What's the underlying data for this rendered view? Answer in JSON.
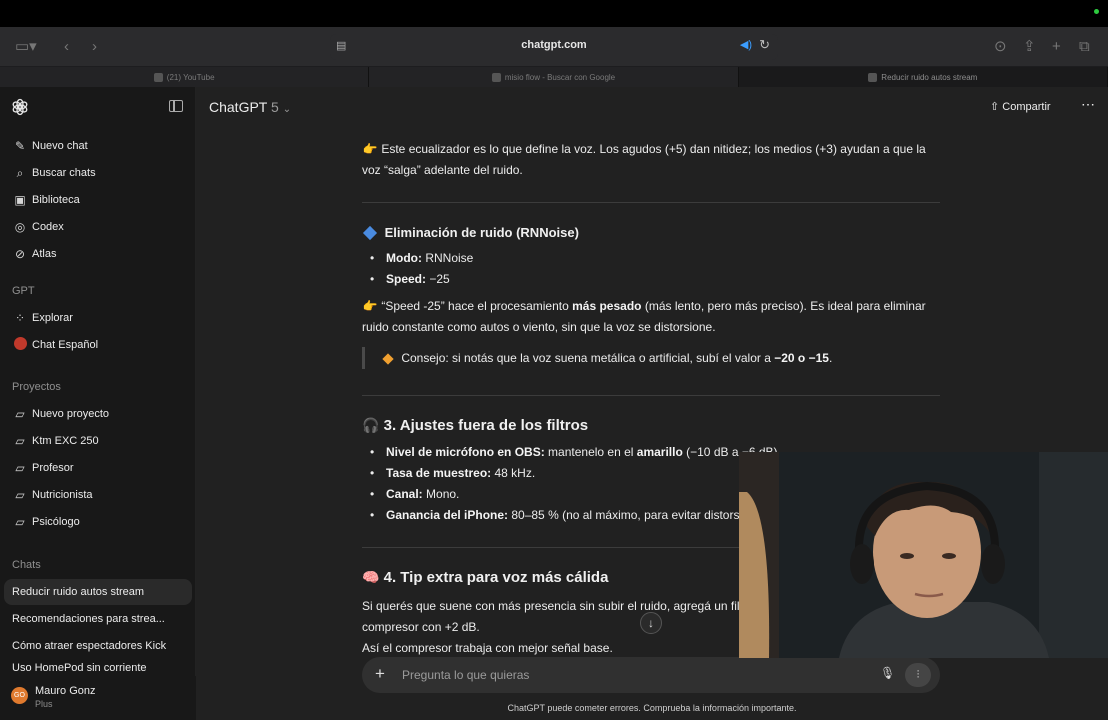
{
  "browser": {
    "url": "chatgpt.com",
    "tabs": [
      {
        "label": "(21) YouTube"
      },
      {
        "label": "misio flow - Buscar con Google"
      },
      {
        "label": "Reducir ruido autos stream"
      }
    ]
  },
  "sidebar": {
    "nav": [
      {
        "label": "Nuevo chat",
        "icon": "edit-icon"
      },
      {
        "label": "Buscar chats",
        "icon": "search-icon"
      },
      {
        "label": "Biblioteca",
        "icon": "library-icon"
      },
      {
        "label": "Codex",
        "icon": "codex-icon"
      },
      {
        "label": "Atlas",
        "icon": "compass-icon"
      }
    ],
    "gpt_heading": "GPT",
    "gpts": [
      {
        "label": "Explorar",
        "icon": "grid-icon"
      },
      {
        "label": "Chat Español",
        "icon": "avatar-icon"
      }
    ],
    "projects_heading": "Proyectos",
    "projects": [
      {
        "label": "Nuevo proyecto"
      },
      {
        "label": "Ktm EXC 250"
      },
      {
        "label": "Profesor"
      },
      {
        "label": "Nutricionista"
      },
      {
        "label": "Psicólogo"
      }
    ],
    "chats_heading": "Chats",
    "chats": [
      {
        "label": "Reducir ruido autos stream"
      },
      {
        "label": "Recomendaciones para strea..."
      },
      {
        "label": "Cómo atraer espectadores Kick"
      },
      {
        "label": "Uso HomePod sin corriente"
      }
    ],
    "user": {
      "initials": "GO",
      "name": "Mauro Gonz",
      "plan": "Plus"
    }
  },
  "header": {
    "model": "ChatGPT",
    "version": "5",
    "share_label": "Compartir"
  },
  "content": {
    "eq_line1": "Este ecualizador es lo que define la voz. Los agudos (+5) dan nitidez; los medios (+3) ayudan a que la",
    "eq_line2": "voz “salga” adelante del ruido.",
    "noise_heading": "Eliminación de ruido (RNNoise)",
    "mode_label": "Modo:",
    "mode_value": "RNNoise",
    "speed_label": "Speed:",
    "speed_value": "−25",
    "speed_p1a": "“Speed -25” hace el procesamiento ",
    "speed_p1b": "más pesado",
    "speed_p1c": " (más lento, pero más preciso). Es ideal para eliminar",
    "speed_p2": "ruido constante como autos o viento, sin que la voz se distorsione.",
    "tip_a": "Consejo: si notás que la voz suena metálica o artificial, subí el valor a ",
    "tip_b": "−20 o −15",
    "tip_c": ".",
    "section3_heading": "3. Ajustes fuera de los filtros",
    "s3_items": [
      {
        "label": "Nivel de micrófono en OBS:",
        "text_a": " mantenelo en el ",
        "bold": "amarillo",
        "text_b": " (−10 dB a −6 dB)."
      },
      {
        "label": "Tasa de muestreo:",
        "text_a": " 48 kHz."
      },
      {
        "label": "Canal:",
        "text_a": " Mono."
      },
      {
        "label": "Ganancia del iPhone:",
        "text_a": " 80–85 % (no al máximo, para evitar distorsión)."
      }
    ],
    "section4_heading": "4. Tip extra para voz más cálida",
    "s4_line1": "Si querés que suene con más presencia sin subir el ruido, agregá un filtro",
    "s4_line2": "compresor con +2 dB.",
    "s4_line3": "Así el compresor trabaja con mejor señal base."
  },
  "composer": {
    "placeholder": "Pregunta lo que quieras",
    "disclaimer": "ChatGPT puede cometer errores. Comprueba la información importante."
  },
  "colors": {
    "accent_blue": "#3b9dff",
    "diamond_blue": "#4a8be0",
    "diamond_orange": "#f0a030",
    "avatar_orange": "#e07a2e"
  }
}
